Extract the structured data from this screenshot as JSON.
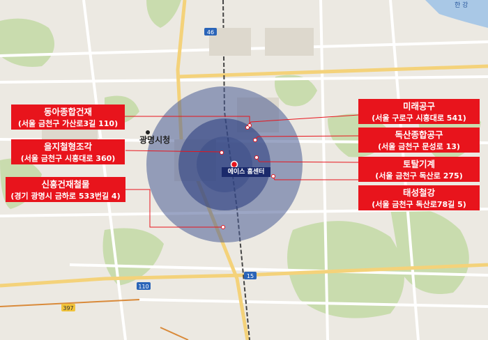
{
  "center": {
    "name": "에이스 홈센터"
  },
  "colors": {
    "label_bg": "#e8141c",
    "leader_line": "#e8141c",
    "circle_outer": "#4b5d96",
    "circle_inner": "#2f4180",
    "center_tag_bg": "#1b2a6b"
  },
  "places": [
    {
      "name": "동아종합건재",
      "address": "(서울 금천구 가산로3길 110)"
    },
    {
      "name": "을지철형조각",
      "address": "(서울 금천구 시흥대로 360)"
    },
    {
      "name": "신흥건재철물",
      "address": "(경기 광명시 금하로 533번길 4)"
    },
    {
      "name": "미래공구",
      "address": "(서울 구로구 시흥대로 541)"
    },
    {
      "name": "독산종합공구",
      "address": "(서울 금천구 문성로 13)"
    },
    {
      "name": "토탈기계",
      "address": "(서울 금천구 독산로 275)"
    },
    {
      "name": "태성철강",
      "address": "(서울 금천구 독산로78길 5)"
    }
  ],
  "map_labels": {
    "gwangmyeong": "광명시청",
    "route_110": "110",
    "route_46": "46",
    "route_15": "15",
    "route_397": "397",
    "han_river": "한 강"
  }
}
